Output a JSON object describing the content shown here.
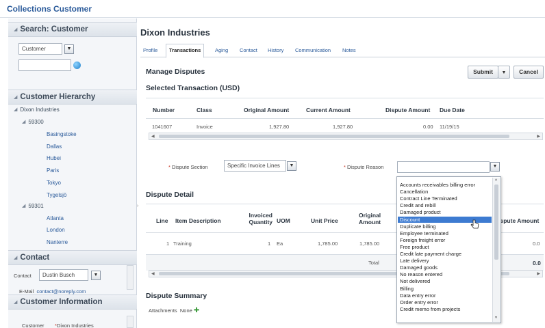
{
  "app": {
    "title": "Collections Customer"
  },
  "left": {
    "search": {
      "header": "Search: Customer",
      "field_value": "Customer"
    },
    "hierarchy": {
      "header": "Customer Hierarchy",
      "root": "Dixon Industries",
      "group1": "59300",
      "group1_items": [
        "Basingstoke",
        "Dallas",
        "Hubei",
        "Paris",
        "Tokyo",
        "Tygelsjö"
      ],
      "group2": "59301",
      "group2_items": [
        "Atlanta",
        "London",
        "Nanterre"
      ]
    },
    "contact": {
      "header": "Contact",
      "label": "Contact",
      "value": "Dustin Busch",
      "email_label": "E-Mail",
      "email_value": "contact@noreply.com"
    },
    "customer_info": {
      "header": "Customer Information",
      "label": "Customer",
      "value": "Dixon Industries"
    }
  },
  "main": {
    "company": "Dixon Industries",
    "tabs": [
      "Profile",
      "Transactions",
      "Aging",
      "Contact",
      "History",
      "Communication",
      "Notes"
    ],
    "active_tab": "Transactions",
    "manage_title": "Manage Disputes",
    "submit_label": "Submit",
    "cancel_label": "Cancel",
    "selected_title": "Selected Transaction (USD)",
    "txn_headers": [
      "Number",
      "Class",
      "Original Amount",
      "Current Amount",
      "Dispute Amount",
      "Due Date"
    ],
    "txn_row": [
      "1041607",
      "Invoice",
      "1,927.80",
      "1,927.80",
      "0.00",
      "11/19/15"
    ],
    "dispute_section_label": "Dispute Section",
    "dispute_section_value": "Specific Invoice Lines",
    "dispute_reason_label": "Dispute Reason",
    "detail_title": "Dispute Detail",
    "detail_headers": {
      "line": "Line",
      "item": "Item Description",
      "qty1": "Invoiced",
      "qty2": "Quantity",
      "uom": "UOM",
      "unit_price": "Unit Price",
      "orig1": "Original",
      "orig2": "Amount",
      "dispute": "Dispute Amount"
    },
    "detail_row": {
      "line": "1",
      "item": "Training",
      "qty": "1",
      "uom": "Ea",
      "unit_price": "1,785.00",
      "orig": "1,785.00",
      "dispute": "0.0"
    },
    "total_label": "Total",
    "total_value": "0.0",
    "summary_title": "Dispute Summary",
    "attachments_label": "Attachments",
    "attachments_value": "None"
  },
  "dropdown": {
    "highlighted": "Discount",
    "options": [
      "Accounts receivables billing error",
      "Cancellation",
      "Contract Line Terminated",
      "Credit and rebill",
      "Damaged product",
      "Discount",
      "Duplicate billing",
      "Employee terminated",
      "Foreign freight error",
      "Free product",
      "Credit late payment charge",
      "Late delivery",
      "Damaged goods",
      "No reason entered",
      "Not delivered",
      "Billing",
      "Data entry error",
      "Order entry error",
      "Credit memo from projects"
    ]
  },
  "colors": {
    "link": "#2a5a9a",
    "highlight": "#3d7bd1",
    "required": "#c7321f"
  }
}
